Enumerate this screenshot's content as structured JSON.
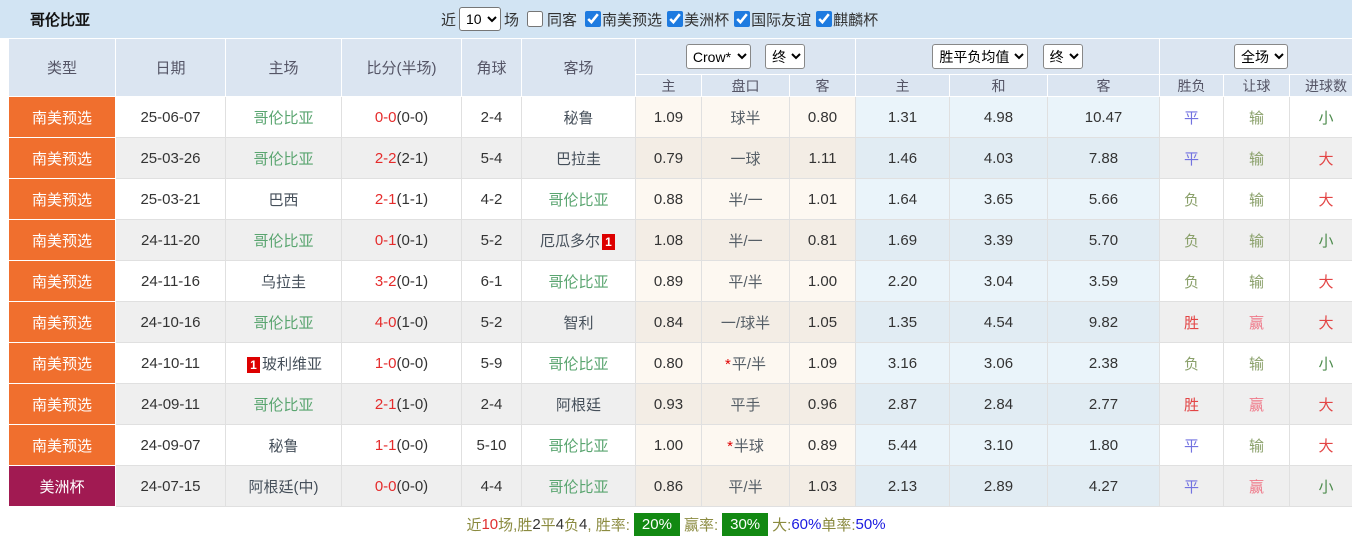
{
  "team": "哥伦比亚",
  "topbar": {
    "near_label": "近",
    "matches_count": "10",
    "matches_label": "场",
    "same_away": {
      "label": "同客",
      "checked": false
    },
    "filters": [
      {
        "label": "南美预选",
        "checked": true
      },
      {
        "label": "美洲杯",
        "checked": true
      },
      {
        "label": "国际友谊",
        "checked": true
      },
      {
        "label": "麒麟杯",
        "checked": true
      }
    ]
  },
  "header": {
    "cols": [
      "类型",
      "日期",
      "主场",
      "比分(半场)",
      "角球",
      "客场"
    ],
    "odds_company_select": "Crow*",
    "odds_state_select": "终",
    "avg_type_select": "胜平负均值",
    "avg_state_select": "终",
    "scope_select": "全场",
    "sub": [
      "主",
      "盘口",
      "客",
      "主",
      "和",
      "客",
      "胜负",
      "让球",
      "进球数"
    ]
  },
  "colors": {
    "qualifier_bg": "#f06f2e",
    "copa_bg": "#a11a52",
    "team_green": "#5aa570",
    "score_red": "#e52b2b",
    "draw_blue": "#7272e0",
    "lose_olive": "#8aa06a",
    "win_red": "#e34545",
    "win_pink": "#ef7888",
    "under_green": "#4e8c4e",
    "badge_green": "#128912"
  },
  "rows": [
    {
      "type": "南美预选",
      "type_style": "qual",
      "date": "25-06-07",
      "home": "哥伦比亚",
      "home_green": true,
      "home_badge": "",
      "score_ft": "0-0",
      "score_ht": "(0-0)",
      "corner": "2-4",
      "away": "秘鲁",
      "away_green": false,
      "away_badge": "",
      "odds_home": "1.09",
      "odds_star": false,
      "odds_line": "球半",
      "odds_away": "0.80",
      "avg_home": "1.31",
      "avg_draw": "4.98",
      "avg_away": "10.47",
      "wdl": "平",
      "wdl_style": "draw",
      "let": "输",
      "let_style": "lose",
      "goal": "小",
      "goal_style": "under"
    },
    {
      "type": "南美预选",
      "type_style": "qual",
      "date": "25-03-26",
      "home": "哥伦比亚",
      "home_green": true,
      "home_badge": "",
      "score_ft": "2-2",
      "score_ht": "(2-1)",
      "corner": "5-4",
      "away": "巴拉圭",
      "away_green": false,
      "away_badge": "",
      "odds_home": "0.79",
      "odds_star": false,
      "odds_line": "一球",
      "odds_away": "1.11",
      "avg_home": "1.46",
      "avg_draw": "4.03",
      "avg_away": "7.88",
      "wdl": "平",
      "wdl_style": "draw",
      "let": "输",
      "let_style": "lose",
      "goal": "大",
      "goal_style": "over"
    },
    {
      "type": "南美预选",
      "type_style": "qual",
      "date": "25-03-21",
      "home": "巴西",
      "home_green": false,
      "home_badge": "",
      "score_ft": "2-1",
      "score_ht": "(1-1)",
      "corner": "4-2",
      "away": "哥伦比亚",
      "away_green": true,
      "away_badge": "",
      "odds_home": "0.88",
      "odds_star": false,
      "odds_line": "半/一",
      "odds_away": "1.01",
      "avg_home": "1.64",
      "avg_draw": "3.65",
      "avg_away": "5.66",
      "wdl": "负",
      "wdl_style": "lose",
      "let": "输",
      "let_style": "lose",
      "goal": "大",
      "goal_style": "over"
    },
    {
      "type": "南美预选",
      "type_style": "qual",
      "date": "24-11-20",
      "home": "哥伦比亚",
      "home_green": true,
      "home_badge": "",
      "score_ft": "0-1",
      "score_ht": "(0-1)",
      "corner": "5-2",
      "away": "厄瓜多尔",
      "away_green": false,
      "away_badge": "1",
      "odds_home": "1.08",
      "odds_star": false,
      "odds_line": "半/一",
      "odds_away": "0.81",
      "avg_home": "1.69",
      "avg_draw": "3.39",
      "avg_away": "5.70",
      "wdl": "负",
      "wdl_style": "lose",
      "let": "输",
      "let_style": "lose",
      "goal": "小",
      "goal_style": "under"
    },
    {
      "type": "南美预选",
      "type_style": "qual",
      "date": "24-11-16",
      "home": "乌拉圭",
      "home_green": false,
      "home_badge": "",
      "score_ft": "3-2",
      "score_ht": "(0-1)",
      "corner": "6-1",
      "away": "哥伦比亚",
      "away_green": true,
      "away_badge": "",
      "odds_home": "0.89",
      "odds_star": false,
      "odds_line": "平/半",
      "odds_away": "1.00",
      "avg_home": "2.20",
      "avg_draw": "3.04",
      "avg_away": "3.59",
      "wdl": "负",
      "wdl_style": "lose",
      "let": "输",
      "let_style": "lose",
      "goal": "大",
      "goal_style": "over"
    },
    {
      "type": "南美预选",
      "type_style": "qual",
      "date": "24-10-16",
      "home": "哥伦比亚",
      "home_green": true,
      "home_badge": "",
      "score_ft": "4-0",
      "score_ht": "(1-0)",
      "corner": "5-2",
      "away": "智利",
      "away_green": false,
      "away_badge": "",
      "odds_home": "0.84",
      "odds_star": false,
      "odds_line": "一/球半",
      "odds_away": "1.05",
      "avg_home": "1.35",
      "avg_draw": "4.54",
      "avg_away": "9.82",
      "wdl": "胜",
      "wdl_style": "win",
      "let": "赢",
      "let_style": "winp",
      "goal": "大",
      "goal_style": "over"
    },
    {
      "type": "南美预选",
      "type_style": "qual",
      "date": "24-10-11",
      "home": "玻利维亚",
      "home_green": false,
      "home_badge": "1",
      "score_ft": "1-0",
      "score_ht": "(0-0)",
      "corner": "5-9",
      "away": "哥伦比亚",
      "away_green": true,
      "away_badge": "",
      "odds_home": "0.80",
      "odds_star": true,
      "odds_line": "平/半",
      "odds_away": "1.09",
      "avg_home": "3.16",
      "avg_draw": "3.06",
      "avg_away": "2.38",
      "wdl": "负",
      "wdl_style": "lose",
      "let": "输",
      "let_style": "lose",
      "goal": "小",
      "goal_style": "under"
    },
    {
      "type": "南美预选",
      "type_style": "qual",
      "date": "24-09-11",
      "home": "哥伦比亚",
      "home_green": true,
      "home_badge": "",
      "score_ft": "2-1",
      "score_ht": "(1-0)",
      "corner": "2-4",
      "away": "阿根廷",
      "away_green": false,
      "away_badge": "",
      "odds_home": "0.93",
      "odds_star": false,
      "odds_line": "平手",
      "odds_away": "0.96",
      "avg_home": "2.87",
      "avg_draw": "2.84",
      "avg_away": "2.77",
      "wdl": "胜",
      "wdl_style": "win",
      "let": "赢",
      "let_style": "winp",
      "goal": "大",
      "goal_style": "over"
    },
    {
      "type": "南美预选",
      "type_style": "qual",
      "date": "24-09-07",
      "home": "秘鲁",
      "home_green": false,
      "home_badge": "",
      "score_ft": "1-1",
      "score_ht": "(0-0)",
      "corner": "5-10",
      "away": "哥伦比亚",
      "away_green": true,
      "away_badge": "",
      "odds_home": "1.00",
      "odds_star": true,
      "odds_line": "半球",
      "odds_away": "0.89",
      "avg_home": "5.44",
      "avg_draw": "3.10",
      "avg_away": "1.80",
      "wdl": "平",
      "wdl_style": "draw",
      "let": "输",
      "let_style": "lose",
      "goal": "大",
      "goal_style": "over"
    },
    {
      "type": "美洲杯",
      "type_style": "copa",
      "date": "24-07-15",
      "home": "阿根廷(中)",
      "home_green": false,
      "home_badge": "",
      "score_ft": "0-0",
      "score_ht": "(0-0)",
      "corner": "4-4",
      "away": "哥伦比亚",
      "away_green": true,
      "away_badge": "",
      "odds_home": "0.86",
      "odds_star": false,
      "odds_line": "平/半",
      "odds_away": "1.03",
      "avg_home": "2.13",
      "avg_draw": "2.89",
      "avg_away": "4.27",
      "wdl": "平",
      "wdl_style": "draw",
      "let": "赢",
      "let_style": "winp",
      "goal": "小",
      "goal_style": "under"
    }
  ],
  "footer": {
    "segments": [
      {
        "text": "近",
        "style": "olive"
      },
      {
        "text": "10",
        "style": "red"
      },
      {
        "text": "场,胜",
        "style": "olive"
      },
      {
        "text": "2",
        "style": "dark"
      },
      {
        "text": "平",
        "style": "olive"
      },
      {
        "text": "4",
        "style": "dark"
      },
      {
        "text": "负",
        "style": "olive"
      },
      {
        "text": "4",
        "style": "dark"
      },
      {
        "text": ", 胜率:",
        "style": "olive"
      },
      {
        "text": "20%",
        "style": "badge"
      },
      {
        "text": " 赢率:",
        "style": "olive"
      },
      {
        "text": "30%",
        "style": "badge"
      },
      {
        "text": " 大:",
        "style": "olive"
      },
      {
        "text": "60%",
        "style": "blue"
      },
      {
        "text": " 单率:",
        "style": "olive"
      },
      {
        "text": "50%",
        "style": "blue"
      }
    ]
  }
}
